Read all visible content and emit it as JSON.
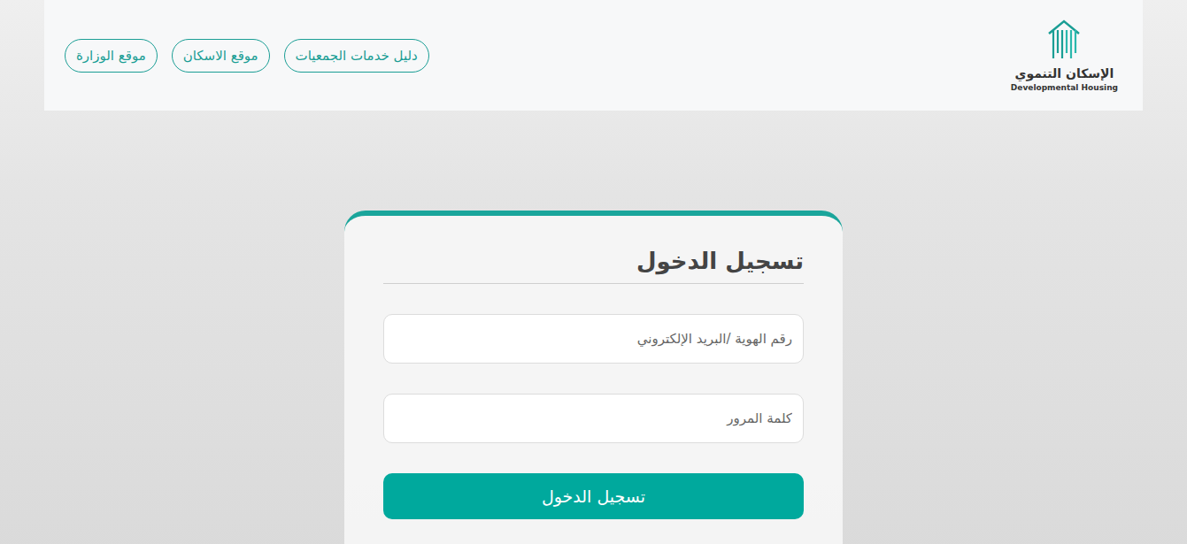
{
  "header": {
    "logo": {
      "title": "الإسكان التنموي",
      "subtitle": "Developmental Housing"
    },
    "nav": [
      {
        "label": "دليل خدمات الجمعيات"
      },
      {
        "label": "موقع الاسكان"
      },
      {
        "label": "موقع الوزارة"
      }
    ]
  },
  "login": {
    "title": "تسجيل الدخول",
    "fields": [
      {
        "placeholder": "رقم الهوية /البريد الإلكتروني",
        "kind": "text"
      },
      {
        "placeholder": "كلمة المرور",
        "kind": "password"
      }
    ],
    "button": "تسجيل الدخول"
  }
}
